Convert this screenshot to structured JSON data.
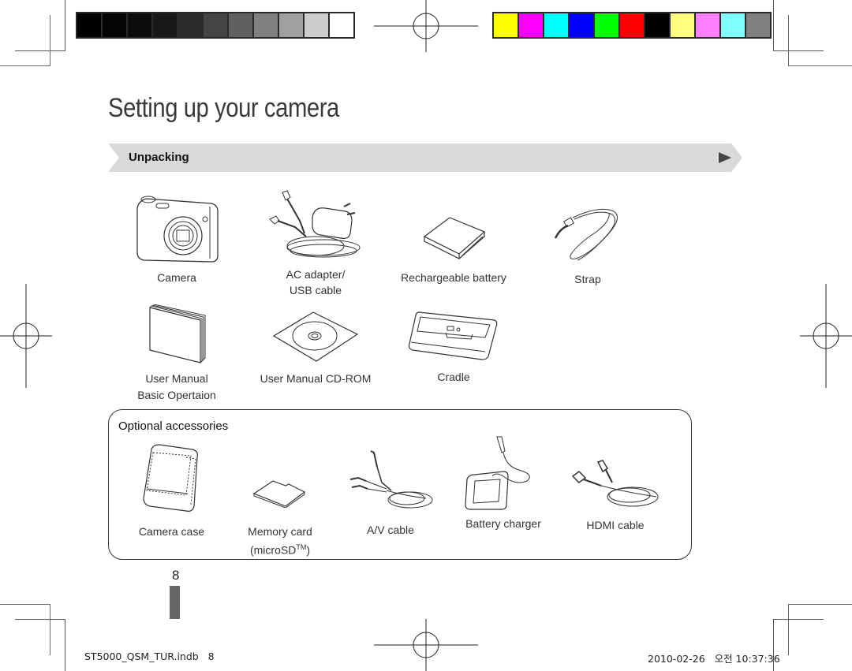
{
  "print_marks": {
    "grayscale_swatches": [
      "#000000",
      "#040404",
      "#0c0c0c",
      "#181818",
      "#2a2a2a",
      "#444444",
      "#606060",
      "#808080",
      "#a0a0a0",
      "#cccccc",
      "#ffffff"
    ],
    "color_swatches": [
      "#ffff00",
      "#ff00ff",
      "#00ffff",
      "#0000ff",
      "#00ff00",
      "#ff0000",
      "#000000",
      "#ffff80",
      "#ff80ff",
      "#80ffff",
      "#808080"
    ]
  },
  "page": {
    "title": "Setting up your camera",
    "section": {
      "label": "Unpacking",
      "bar_color": "#d9d9d9",
      "arrow_color": "#444444"
    },
    "included_items": [
      {
        "icon": "camera-icon",
        "label": "Camera",
        "label2": ""
      },
      {
        "icon": "ac-adapter-icon",
        "label": "AC adapter/",
        "label2": "USB cable"
      },
      {
        "icon": "battery-icon",
        "label": "Rechargeable battery",
        "label2": ""
      },
      {
        "icon": "strap-icon",
        "label": "Strap",
        "label2": ""
      },
      {
        "icon": "manual-book-icon",
        "label": "User Manual",
        "label2": "Basic Opertaion"
      },
      {
        "icon": "cd-rom-icon",
        "label": "User Manual CD-ROM",
        "label2": ""
      },
      {
        "icon": "cradle-icon",
        "label": "Cradle",
        "label2": ""
      }
    ],
    "optional": {
      "title": "Optional accessories",
      "items": [
        {
          "icon": "camera-case-icon",
          "label": "Camera case",
          "label2": ""
        },
        {
          "icon": "memory-card-icon",
          "label": "Memory card",
          "label2": "(microSD",
          "trademark": "TM",
          "label2_end": ")"
        },
        {
          "icon": "av-cable-icon",
          "label": "A/V cable",
          "label2": ""
        },
        {
          "icon": "battery-charger-icon",
          "label": "Battery charger",
          "label2": ""
        },
        {
          "icon": "hdmi-cable-icon",
          "label": "HDMI cable",
          "label2": ""
        }
      ]
    },
    "page_number": "8"
  },
  "slug": {
    "file": "ST5000_QSM_TUR.indb   8",
    "datetime": "2010-02-26   오전 10:37:36"
  }
}
